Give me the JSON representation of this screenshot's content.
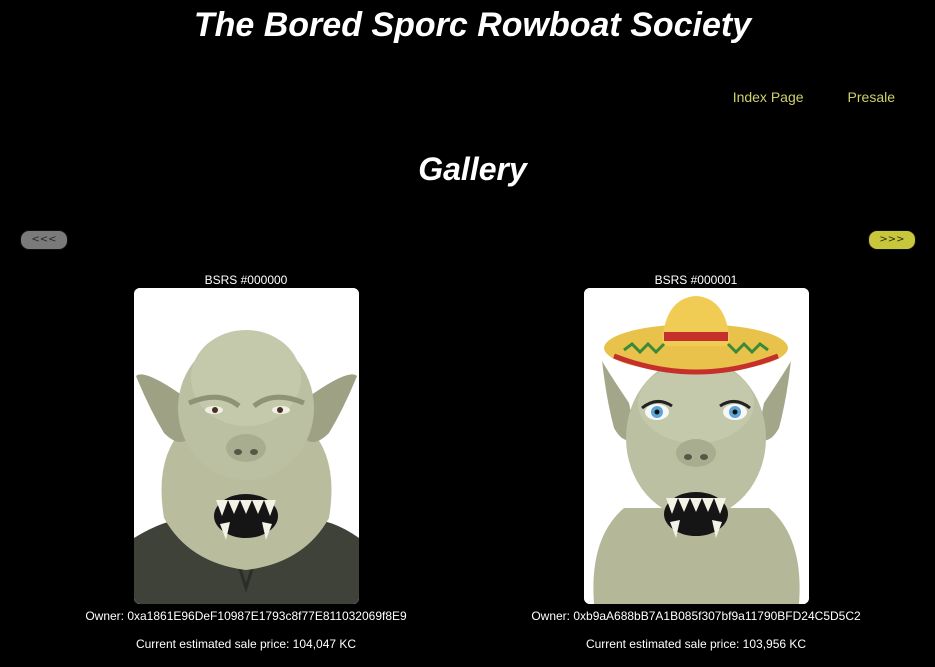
{
  "header": {
    "title": "The Bored Sporc Rowboat Society"
  },
  "nav": {
    "items": [
      {
        "label": "Index Page"
      },
      {
        "label": "Presale"
      }
    ],
    "link_color": "#cfd16a"
  },
  "gallery": {
    "title": "Gallery",
    "prev_label": "<<<",
    "next_label": ">>>",
    "prev_color": "#7a7a7a",
    "next_color": "#c8c73c",
    "items": [
      {
        "id": "BSRS #000000",
        "owner": "Owner: 0xa1861E96DeF10987E1793c8f77E811032069f8E9",
        "price": "Current estimated sale price: 104,047 KC",
        "image": "orc-portrait-dark-shirt"
      },
      {
        "id": "BSRS #000001",
        "owner": "Owner: 0xb9aA688bB7A1B085f307bf9a11790BFD24C5D5C2",
        "price": "Current estimated sale price: 103,956 KC",
        "image": "orc-portrait-sombrero-blue-eyes"
      }
    ]
  }
}
